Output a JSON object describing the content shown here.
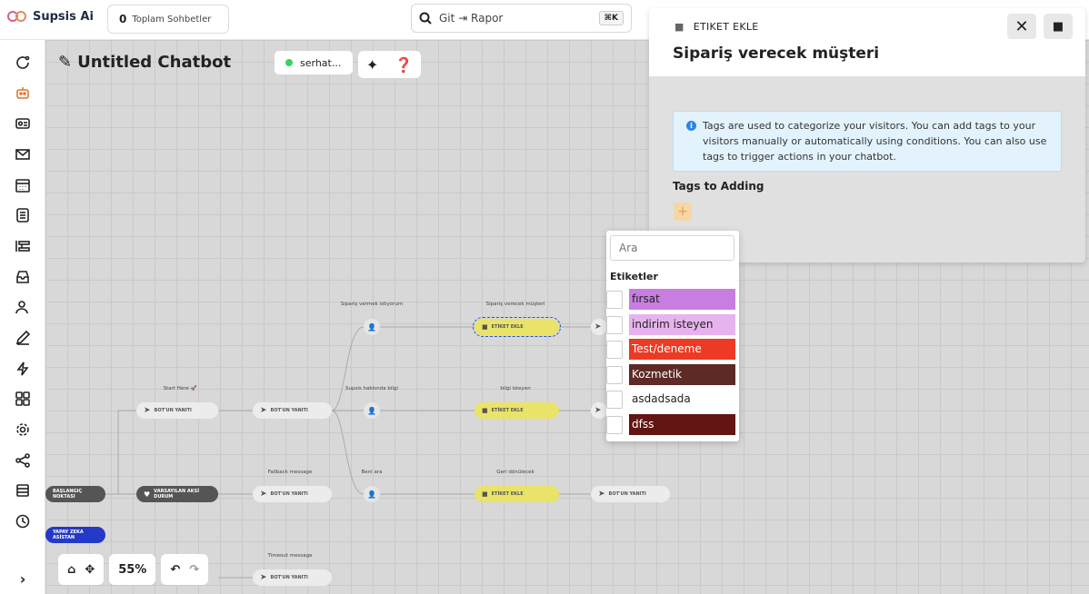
{
  "app": {
    "name": "Supsis Ai"
  },
  "topbar": {
    "counter_value": "0",
    "counter_label": "Toplam Sohbetler",
    "search_value": "Git ⇥ Rapor",
    "search_shortcut": "⌘K"
  },
  "sidebar": {
    "items": [
      "chat-icon",
      "bot-icon",
      "contact-card-icon",
      "mail-icon",
      "calendar-icon",
      "list-icon",
      "kanban-icon",
      "inbox-icon",
      "users-icon",
      "edit-icon",
      "lightning-icon",
      "apps-icon",
      "settings-icon",
      "share-icon",
      "archive-icon",
      "history-icon"
    ],
    "expand": "›"
  },
  "editor": {
    "title": "Untitled Chatbot",
    "user": "serhat...",
    "zoom": "55%"
  },
  "flow": {
    "labels": {
      "start": "Start Here 🚀",
      "siparis_vermek": "Sipariş vermek istiyorum",
      "siparis_verecek": "Sipariş verecek müşteri",
      "supsis": "Supsis hakkında bilgi",
      "bilgi": "bilgi isteyen",
      "fallback": "Fallback message",
      "beni_ara": "Beni ara",
      "geri": "Geri dönülecek",
      "timeout": "Timeout message"
    },
    "nodes": {
      "bot_yaniti": "BOT'UN YANITI",
      "etiket_ekle": "ETİKET EKLE",
      "baslangic": "BAŞLANGIÇ NOKTASI",
      "varsayilan": "VARSAYILAN AKSİ DURUM",
      "yapay_zeka": "YAPAY ZEKA ASİSTAN"
    }
  },
  "panel": {
    "type": "ETIKET EKLE",
    "title": "Sipariş verecek müşteri",
    "info": "Tags are used to categorize your visitors. You can add tags to your visitors manually or automatically using conditions. You can also use tags to trigger actions in your chatbot.",
    "tags_label": "Tags to Adding",
    "add": "+"
  },
  "dropdown": {
    "placeholder": "Ara",
    "header": "Etiketler",
    "tags": [
      {
        "name": "fırsat",
        "color": "#c77ee0",
        "text": "#222"
      },
      {
        "name": "indirim isteyen",
        "color": "#e7b3ee",
        "text": "#222"
      },
      {
        "name": "Test/deneme",
        "color": "#ec3a24",
        "text": "#fff"
      },
      {
        "name": "Kozmetik",
        "color": "#5e2a25",
        "text": "#fff"
      },
      {
        "name": "asdadsada",
        "color": "#ffffff",
        "text": "#222"
      },
      {
        "name": "dfss",
        "color": "#621513",
        "text": "#fff"
      }
    ]
  }
}
